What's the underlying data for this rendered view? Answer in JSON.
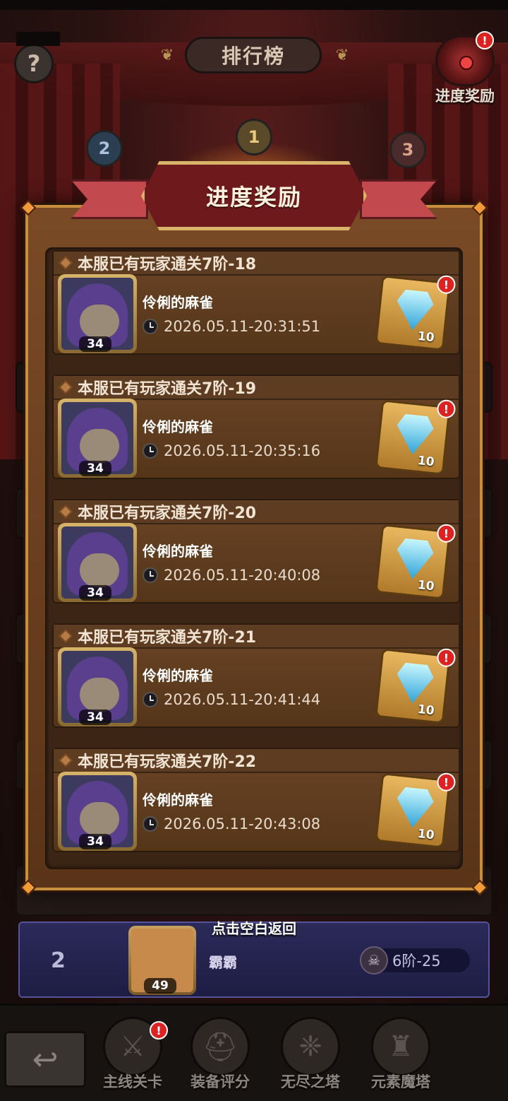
{
  "header": {
    "title": "排行榜",
    "help_symbol": "?",
    "progress_reward_label": "进度奖励",
    "alert_symbol": "!"
  },
  "podium": {
    "ranks": [
      "1",
      "2",
      "3"
    ]
  },
  "modal": {
    "title": "进度奖励",
    "records": [
      {
        "title": "本服已有玩家通关7阶-18",
        "player": "伶俐的麻雀",
        "level": "34",
        "time": "2026.05.11-20:31:51",
        "reward_count": "10"
      },
      {
        "title": "本服已有玩家通关7阶-19",
        "player": "伶俐的麻雀",
        "level": "34",
        "time": "2026.05.11-20:35:16",
        "reward_count": "10"
      },
      {
        "title": "本服已有玩家通关7阶-20",
        "player": "伶俐的麻雀",
        "level": "34",
        "time": "2026.05.11-20:40:08",
        "reward_count": "10"
      },
      {
        "title": "本服已有玩家通关7阶-21",
        "player": "伶俐的麻雀",
        "level": "34",
        "time": "2026.05.11-20:41:44",
        "reward_count": "10"
      },
      {
        "title": "本服已有玩家通关7阶-22",
        "player": "伶俐的麻雀",
        "level": "34",
        "time": "2026.05.11-20:43:08",
        "reward_count": "10"
      }
    ]
  },
  "tap_hint": "点击空白返回",
  "my_rank": {
    "rank": "2",
    "name": "霸霸",
    "level": "49",
    "stage": "6阶-25"
  },
  "bottom_nav": {
    "items": [
      {
        "label": "主线关卡",
        "icon": "sword-icon"
      },
      {
        "label": "装备评分",
        "icon": "helmet-icon"
      },
      {
        "label": "无尽之塔",
        "icon": "crystal-icon"
      },
      {
        "label": "元素魔塔",
        "icon": "tower-icon"
      }
    ]
  },
  "colors": {
    "gem": "#2fa4d6",
    "alert": "#dd2222",
    "banner": "#6e1a1c"
  }
}
